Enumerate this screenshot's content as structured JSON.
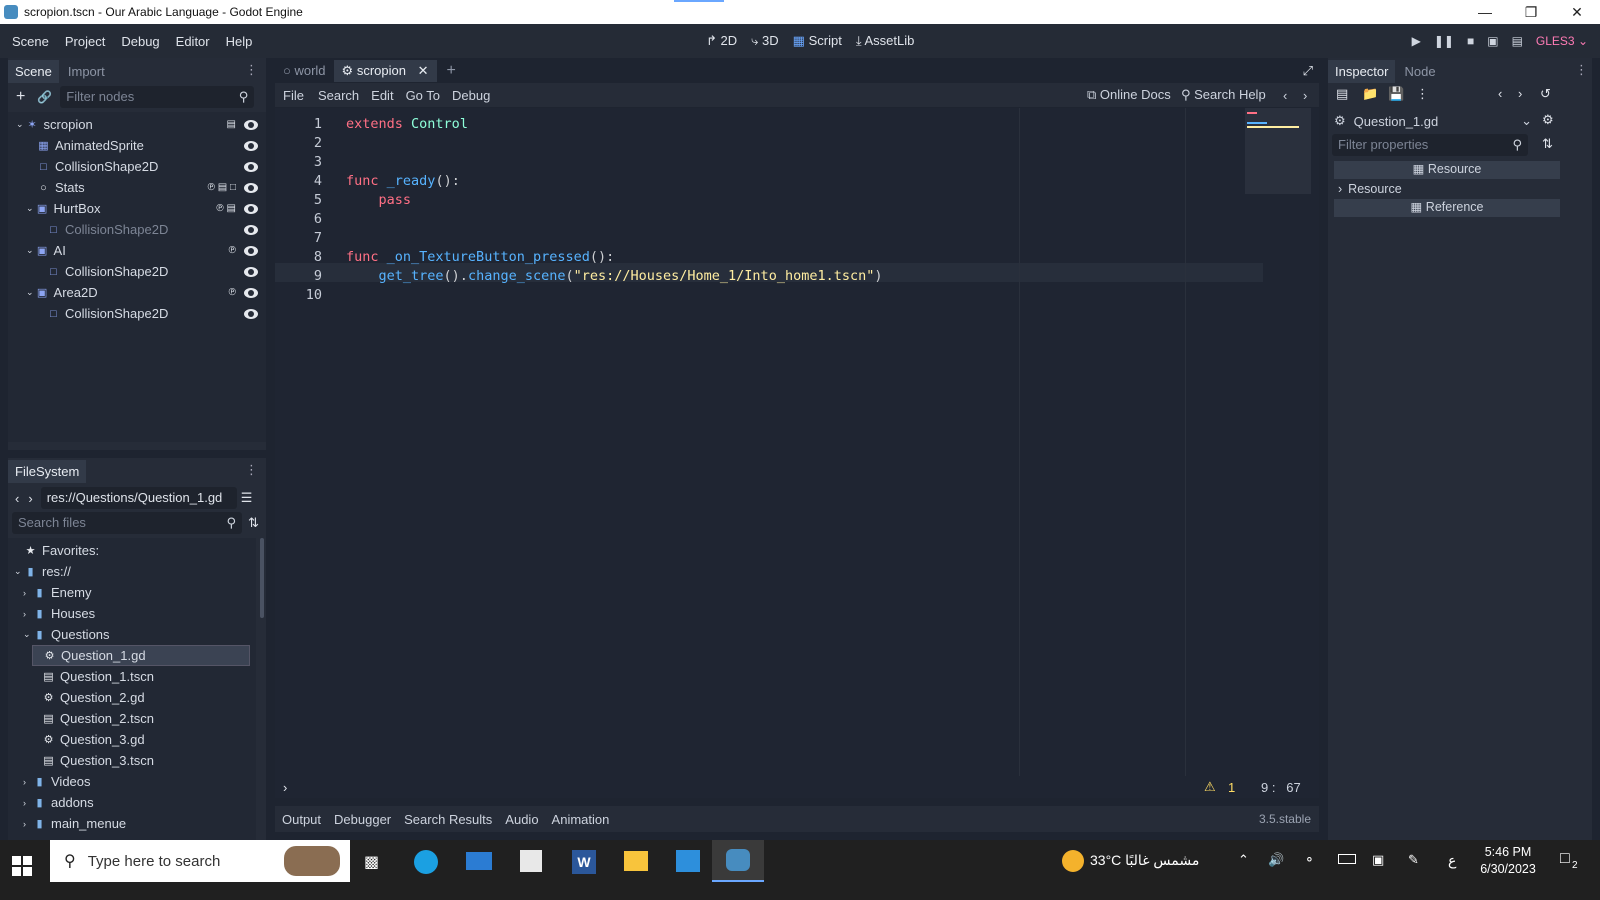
{
  "window": {
    "title": "scropion.tscn - Our Arabic Language - Godot Engine"
  },
  "menu": {
    "items": [
      "Scene",
      "Project",
      "Debug",
      "Editor",
      "Help"
    ]
  },
  "modes": {
    "d2": "2D",
    "d3": "3D",
    "script": "Script",
    "assetlib": "AssetLib"
  },
  "renderer": "GLES3",
  "scene_dock": {
    "tabs": [
      "Scene",
      "Import"
    ],
    "filter_placeholder": "Filter nodes",
    "nodes": [
      {
        "name": "scropion",
        "depth": 0,
        "icon": "root-node-icon"
      },
      {
        "name": "AnimatedSprite",
        "depth": 1,
        "icon": "sprite-icon"
      },
      {
        "name": "CollisionShape2D",
        "depth": 1,
        "icon": "shape-icon"
      },
      {
        "name": "Stats",
        "depth": 1,
        "icon": "circle-node-icon"
      },
      {
        "name": "HurtBox",
        "depth": 1,
        "icon": "area-icon"
      },
      {
        "name": "CollisionShape2D",
        "depth": 2,
        "icon": "shape-icon",
        "dim": true
      },
      {
        "name": "AI",
        "depth": 1,
        "icon": "area-icon"
      },
      {
        "name": "CollisionShape2D",
        "depth": 2,
        "icon": "shape-icon"
      },
      {
        "name": "Area2D",
        "depth": 1,
        "icon": "area-icon"
      },
      {
        "name": "CollisionShape2D",
        "depth": 2,
        "icon": "shape-icon"
      }
    ]
  },
  "filesystem": {
    "title": "FileSystem",
    "path": "res://Questions/Question_1.gd",
    "search_placeholder": "Search files",
    "items": [
      {
        "name": "Favorites:",
        "depth": 0,
        "icon": "star-icon"
      },
      {
        "name": "res://",
        "depth": 0,
        "icon": "folder-icon"
      },
      {
        "name": "Enemy",
        "depth": 1,
        "icon": "folder-icon"
      },
      {
        "name": "Houses",
        "depth": 1,
        "icon": "folder-icon"
      },
      {
        "name": "Questions",
        "depth": 1,
        "icon": "folder-icon"
      },
      {
        "name": "Question_1.gd",
        "depth": 2,
        "icon": "gear-icon",
        "selected": true
      },
      {
        "name": "Question_1.tscn",
        "depth": 2,
        "icon": "scene-file-icon"
      },
      {
        "name": "Question_2.gd",
        "depth": 2,
        "icon": "gear-icon"
      },
      {
        "name": "Question_2.tscn",
        "depth": 2,
        "icon": "scene-file-icon"
      },
      {
        "name": "Question_3.gd",
        "depth": 2,
        "icon": "gear-icon"
      },
      {
        "name": "Question_3.tscn",
        "depth": 2,
        "icon": "scene-file-icon"
      },
      {
        "name": "Videos",
        "depth": 1,
        "icon": "folder-icon"
      },
      {
        "name": "addons",
        "depth": 1,
        "icon": "folder-icon"
      },
      {
        "name": "main_menue",
        "depth": 1,
        "icon": "folder-icon"
      }
    ]
  },
  "script_tabs": [
    "world",
    "scropion"
  ],
  "script_menu": {
    "file": "File",
    "search": "Search",
    "edit": "Edit",
    "goto": "Go To",
    "debug": "Debug",
    "online_docs": "Online Docs",
    "search_help": "Search Help"
  },
  "code_lines": [
    "1",
    "2",
    "3",
    "4",
    "5",
    "6",
    "7",
    "8",
    "9",
    "10"
  ],
  "status": {
    "warnings": "1",
    "cursor": "9 :   67",
    "version": "3.5.stable"
  },
  "bottom_tabs": [
    "Output",
    "Debugger",
    "Search Results",
    "Audio",
    "Animation"
  ],
  "inspector": {
    "tabs": [
      "Inspector",
      "Node"
    ],
    "resource_name": "Question_1.gd",
    "filter_placeholder": "Filter properties",
    "section_resource": "Resource",
    "sub_resource": "Resource",
    "section_reference": "Reference"
  },
  "taskbar": {
    "search_placeholder": "Type here to search",
    "weather": "33°C  مشمس غالبًا",
    "lang": "ع",
    "time": "5:46 PM",
    "date": "6/30/2023",
    "notif_count": "2"
  },
  "colors": {
    "accent": "#6aa7ff",
    "keyword": "#ff7085",
    "function": "#57b3ff",
    "class": "#8effda",
    "string": "#ffeda1",
    "bg": "#1f2532"
  }
}
